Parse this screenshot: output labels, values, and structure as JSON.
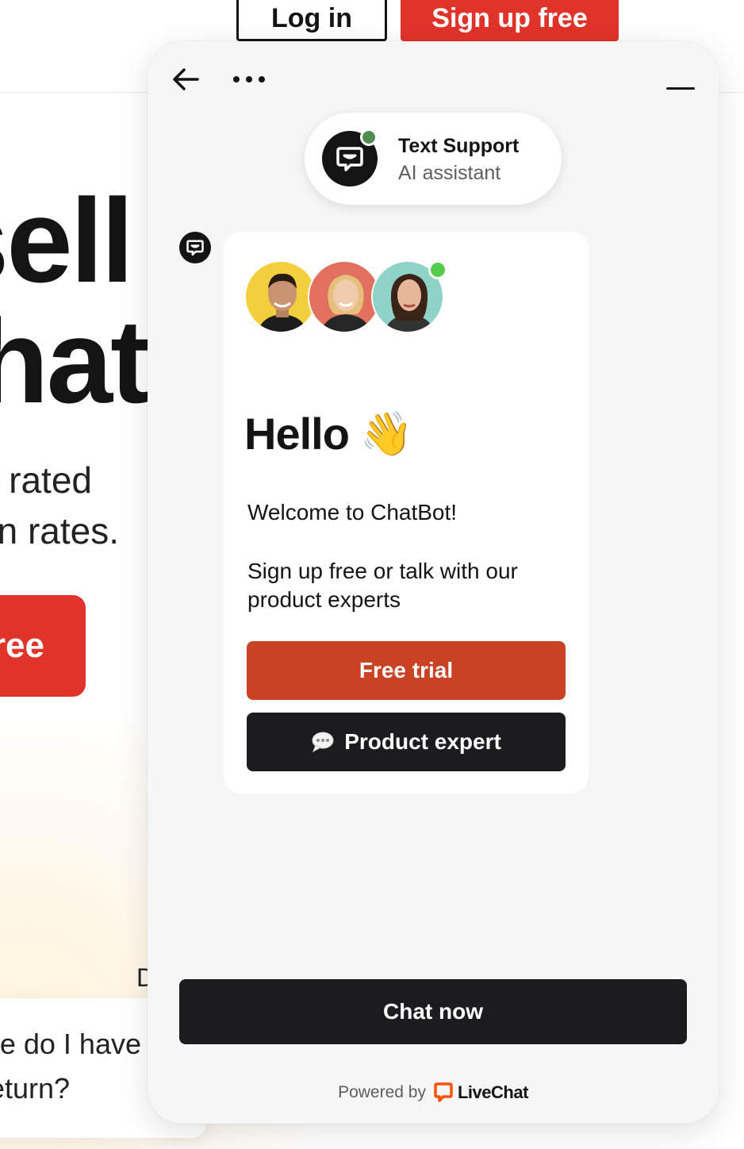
{
  "background": {
    "header": {
      "login_label": "Log in",
      "signup_label": "Sign up free"
    },
    "hero": {
      "line1": "sell",
      "line2": "hat"
    },
    "subtitle": {
      "line1": "rated",
      "line2": "n rates."
    },
    "cta_label": "ree",
    "partial_letter": "D",
    "faq": {
      "line1": "e do I have",
      "line2": "eturn?"
    }
  },
  "widget": {
    "agent": {
      "name": "Text Support",
      "role": "AI assistant"
    },
    "message": {
      "greeting": "Hello",
      "greeting_emoji": "👋",
      "welcome": "Welcome to ChatBot!",
      "body": "Sign up free or talk with our product experts",
      "free_trial_label": "Free trial",
      "product_expert_label": "Product expert"
    },
    "chat_now_label": "Chat now",
    "powered_by": "Powered by",
    "brand_name": "LiveChat"
  },
  "colors": {
    "accent_red": "#e0332a",
    "free_trial": "#c94224",
    "dark_button": "#1c1c20",
    "online_green": "#52cc4a",
    "agent_status_green": "#4f8c54",
    "livechat_orange": "#ff5100"
  },
  "icons": [
    "arrow-left-icon",
    "more-icon",
    "minimize-icon",
    "chatbot-icon",
    "speech-bubble-icon",
    "livechat-logo-icon"
  ]
}
